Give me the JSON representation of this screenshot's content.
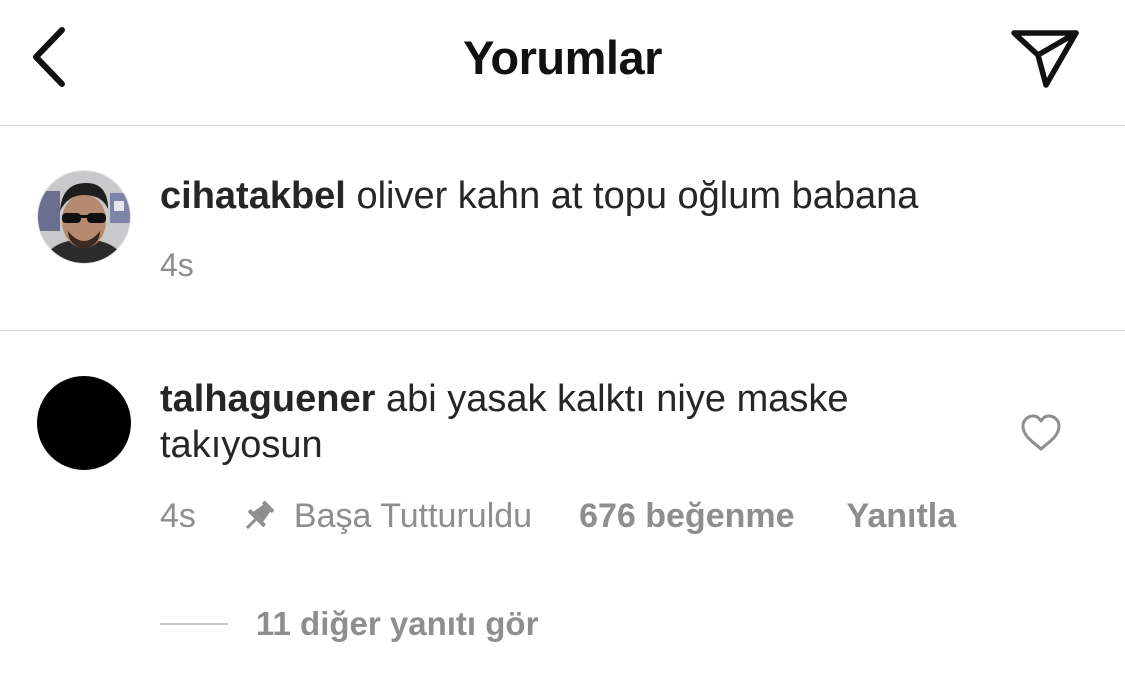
{
  "header": {
    "title": "Yorumlar",
    "back_icon": "chevron-left-icon",
    "send_icon": "paper-plane-icon"
  },
  "caption": {
    "username": "cihatakbel",
    "text": "oliver kahn at topu oğlum babana",
    "time": "4s"
  },
  "comment": {
    "username": "talhaguener",
    "text_line1": "abi yasak kalktı niye maske",
    "text_line2": "takıyosun",
    "time": "4s",
    "pinned_label": "Başa Tutturuldu",
    "likes": "676 beğenme",
    "reply_label": "Yanıtla",
    "view_replies": "11 diğer yanıtı gör"
  },
  "colors": {
    "text": "#262626",
    "secondary": "#8e8e8e",
    "divider": "#dbdbdb"
  }
}
